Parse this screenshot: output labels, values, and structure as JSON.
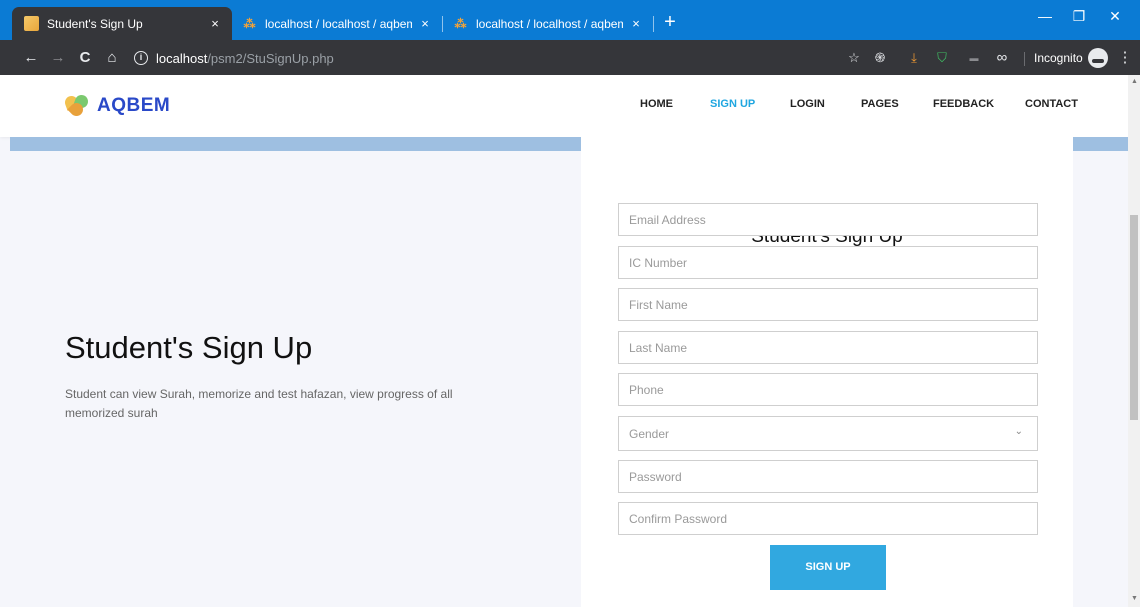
{
  "browser": {
    "tabs": [
      {
        "title": "Student's Sign Up",
        "close": "×"
      },
      {
        "title": "localhost / localhost / aqbem / fo",
        "close": "×"
      },
      {
        "title": "localhost / localhost / aqbem / st",
        "close": "×"
      }
    ],
    "new_tab": "+",
    "window_controls": {
      "minimize": "—",
      "restore": "❐",
      "close": "✕"
    },
    "url_host": "localhost",
    "url_path": "/psm2/StuSignUp.php",
    "incognito_label": "Incognito",
    "nav_buttons": {
      "back": "←",
      "forward": "→",
      "reload": "C",
      "home": "⌂"
    },
    "extensions": [
      {
        "icon": "star-icon",
        "glyph": "☆",
        "color": "#e8eaed"
      },
      {
        "icon": "fingerprint-extension-icon",
        "glyph": "֍",
        "color": "#e8eaed"
      },
      {
        "icon": "download-extension-icon",
        "glyph": "⤓",
        "color": "#f29b33"
      },
      {
        "icon": "shield-extension-icon",
        "glyph": "⛉",
        "color": "#3fbf63"
      },
      {
        "icon": "wappalyzer-extension-icon",
        "glyph": "▬",
        "color": "#8a8b8f"
      },
      {
        "icon": "infinity-extension-icon",
        "glyph": "∞",
        "color": "#e8eaed"
      }
    ],
    "more_menu": "⋮"
  },
  "site": {
    "logo_text": "AQBEM",
    "nav": [
      {
        "label": "HOME",
        "active": false
      },
      {
        "label": "SIGN UP",
        "active": true
      },
      {
        "label": "LOGIN",
        "active": false
      },
      {
        "label": "PAGES",
        "active": false
      },
      {
        "label": "FEEDBACK",
        "active": false
      },
      {
        "label": "CONTACT",
        "active": false
      }
    ],
    "accent_color": "#31a8e0"
  },
  "hero": {
    "title": "Student's Sign Up",
    "description": "Student can view Surah, memorize and test hafazan, view progress of all memorized surah"
  },
  "form": {
    "title": "Student's Sign Up",
    "fields": {
      "email": {
        "placeholder": "Email Address",
        "value": ""
      },
      "ic": {
        "placeholder": "IC Number",
        "value": ""
      },
      "first_name": {
        "placeholder": "First Name",
        "value": ""
      },
      "last_name": {
        "placeholder": "Last Name",
        "value": ""
      },
      "phone": {
        "placeholder": "Phone",
        "value": ""
      },
      "password": {
        "placeholder": "Password",
        "value": ""
      },
      "confirm_password": {
        "placeholder": "Confirm Password",
        "value": ""
      }
    },
    "gender": {
      "selected": "Gender",
      "chevron": "⌄"
    },
    "submit_label": "SIGN UP"
  }
}
